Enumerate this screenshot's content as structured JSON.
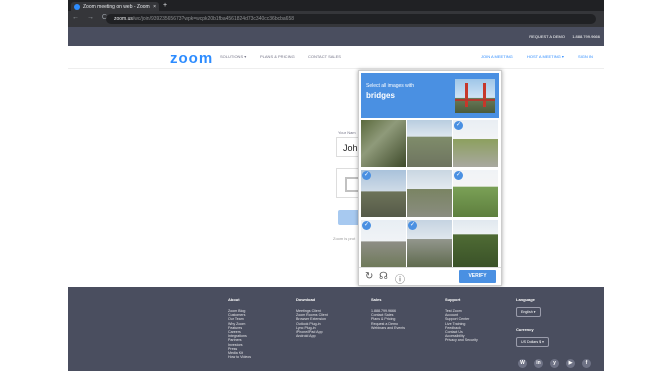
{
  "browser": {
    "tab_title": "Zoom meeting on web - Zoom",
    "tab_close": "×",
    "new_tab": "+",
    "nav_icons": "← → C",
    "url_host": "zoom.us",
    "url_path": "/wc/join/93923565673?wpk=wcpk20b1fba4561824d73c340cc36bcba658"
  },
  "topstrip": {
    "request_demo": "REQUEST A DEMO",
    "phone": "1.888.799.9666"
  },
  "nav": {
    "logo": "zoom",
    "solutions": "SOLUTIONS ▾",
    "plans": "PLANS & PRICING",
    "contact": "CONTACT SALES",
    "join": "JOIN A MEETING",
    "host": "HOST A MEETING ▾",
    "signin": "SIGN IN"
  },
  "form": {
    "your_name_label": "Your Nam",
    "name_value": "Joh",
    "terms_text": "Zoom is prot"
  },
  "captcha": {
    "instruction": "Select all images with",
    "target": "bridges",
    "verify_label": "VERIFY",
    "tiles": [
      {
        "name": "captcha-tile-1",
        "selected": false
      },
      {
        "name": "captcha-tile-2",
        "selected": false
      },
      {
        "name": "captcha-tile-3",
        "selected": true
      },
      {
        "name": "captcha-tile-4",
        "selected": true
      },
      {
        "name": "captcha-tile-5",
        "selected": false
      },
      {
        "name": "captcha-tile-6",
        "selected": true
      },
      {
        "name": "captcha-tile-7",
        "selected": true
      },
      {
        "name": "captcha-tile-8",
        "selected": true
      },
      {
        "name": "captcha-tile-9",
        "selected": false
      }
    ],
    "icons": [
      "reload-icon",
      "audio-icon",
      "info-icon"
    ]
  },
  "footer": {
    "about": {
      "heading": "About",
      "links": [
        "Zoom Blog",
        "Customers",
        "Our Team",
        "Why Zoom",
        "Features",
        "Careers",
        "Integrations",
        "Partners",
        "Investors",
        "Press",
        "Media Kit",
        "How to Videos"
      ]
    },
    "download": {
      "heading": "Download",
      "links": [
        "Meetings Client",
        "Zoom Rooms Client",
        "Browser Extension",
        "Outlook Plug-in",
        "Lync Plug-in",
        "iPhone/iPad App",
        "Android App"
      ]
    },
    "sales": {
      "heading": "Sales",
      "links": [
        "1.888.799.9666",
        "Contact Sales",
        "Plans & Pricing",
        "Request a Demo",
        "Webinars and Events"
      ]
    },
    "support": {
      "heading": "Support",
      "links": [
        "Test Zoom",
        "Account",
        "Support Center",
        "Live Training",
        "Feedback",
        "Contact Us",
        "Accessibility",
        "Privacy and Security"
      ]
    },
    "language": {
      "heading": "Language",
      "value": "English ▾"
    },
    "currency": {
      "heading": "Currency",
      "value": "US Dollars $ ▾"
    },
    "social": [
      "W",
      "in",
      "y",
      "▶",
      "f"
    ]
  }
}
